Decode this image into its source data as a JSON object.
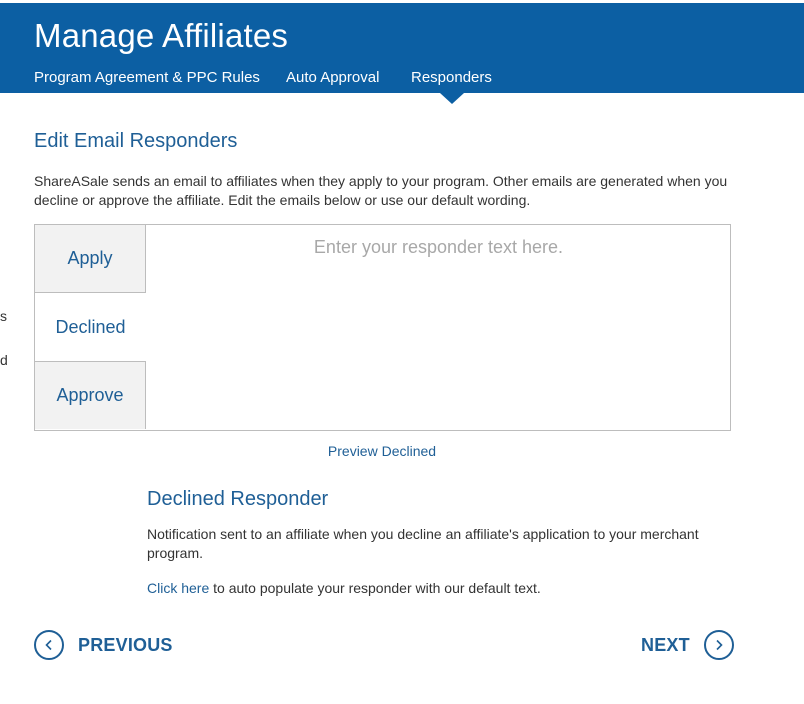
{
  "header": {
    "title": "Manage Affiliates",
    "tabs": [
      {
        "label": "Program Agreement & PPC Rules"
      },
      {
        "label": "Auto Approval"
      },
      {
        "label": "Responders"
      }
    ],
    "active_tab": "Responders",
    "background_color": "#0c5fa3"
  },
  "left_edge_fragments": [
    "s",
    "d"
  ],
  "section": {
    "title": "Edit Email Responders",
    "intro": "ShareASale sends an email to affiliates when they apply to your program. Other emails are generated when you decline or approve the affiliate. Edit the emails below or use our default wording."
  },
  "responder_tabs": [
    {
      "label": "Apply"
    },
    {
      "label": "Declined"
    },
    {
      "label": "Approve"
    }
  ],
  "active_responder": "Declined",
  "editor": {
    "placeholder": "Enter your responder text here.",
    "value": ""
  },
  "preview_link": "Preview Declined",
  "responder_info": {
    "title": "Declined Responder",
    "description": "Notification sent to an affiliate when you decline an affiliate's application to your merchant program.",
    "link_text": "Click here",
    "link_suffix": " to auto populate your responder with our default text."
  },
  "navigation": {
    "previous_label": "PREVIOUS",
    "next_label": "NEXT"
  },
  "icons": {
    "previous": "chevron-left-icon",
    "next": "chevron-right-icon"
  },
  "colors": {
    "accent": "#1f5f96",
    "tab_inactive_bg": "#f2f2f2"
  }
}
